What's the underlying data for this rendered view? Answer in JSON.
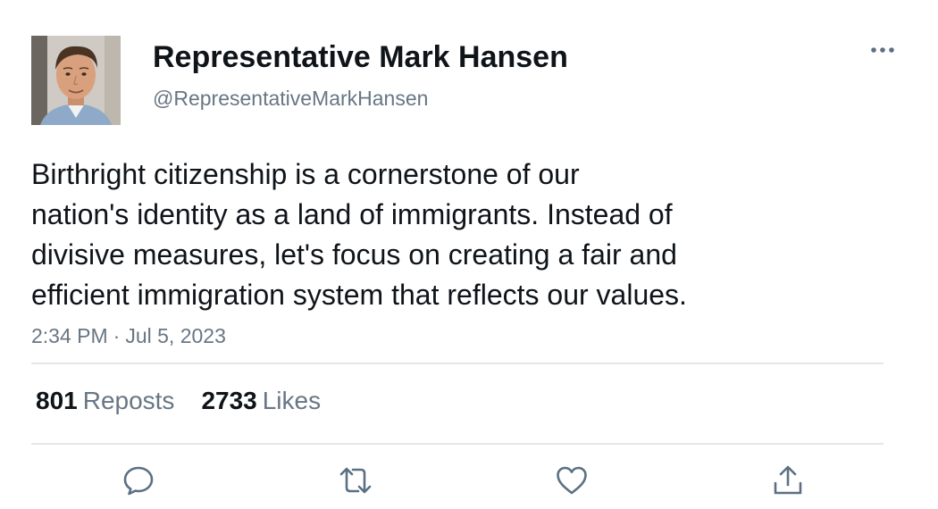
{
  "author": {
    "display_name": "Representative Mark Hansen",
    "handle": "@RepresentativeMarkHansen"
  },
  "tweet": {
    "text_lines": [
      "Birthright citizenship is a cornerstone of our",
      "nation's identity as a land of immigrants. Instead of",
      "divisive measures, let's focus on creating a fair and",
      "efficient immigration system that reflects our values."
    ],
    "time": "2:34 PM",
    "separator": "·",
    "date": "Jul 5, 2023"
  },
  "stats": {
    "reposts_count": "801",
    "reposts_label": "Reposts",
    "likes_count": "2733",
    "likes_label": "Likes"
  },
  "icons": {
    "more": "more-horizontal-icon",
    "reply": "reply-bubble-icon",
    "repost": "repost-arrows-icon",
    "like": "heart-icon",
    "share": "share-upload-icon"
  },
  "colors": {
    "text_primary": "#0f1419",
    "text_secondary": "#687684",
    "divider": "#e3e7ea",
    "icon": "#5b7083"
  }
}
